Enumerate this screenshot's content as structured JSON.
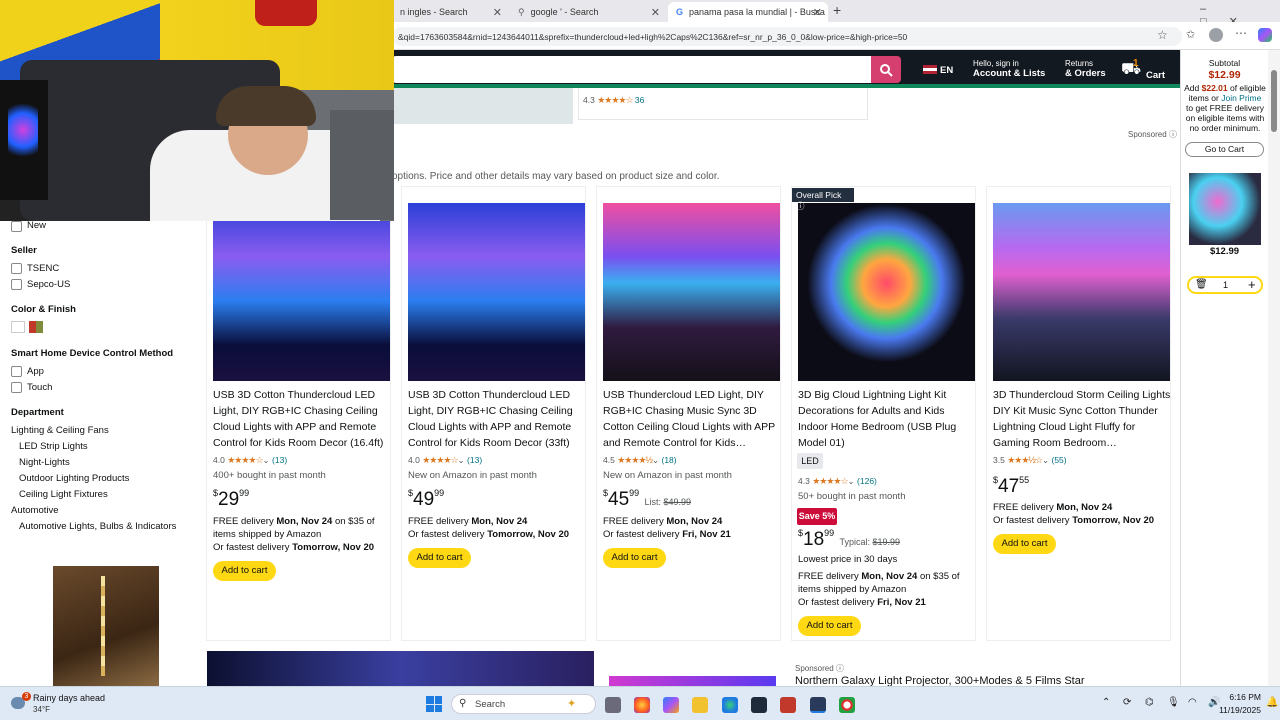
{
  "browser": {
    "tabs": [
      {
        "label": "n ingles - Search"
      },
      {
        "label": "google ' - Search"
      },
      {
        "label": "panama pasa la mundial | - Busca"
      }
    ],
    "url": "&qid=1763603584&rnid=1243644011&sprefix=thundercloud+led+ligh%2Caps%2C136&ref=sr_nr_p_36_0_0&low-price=&high-price=50"
  },
  "header": {
    "lang": "EN",
    "account_line1": "Hello, sign in",
    "account_line2": "Account & Lists",
    "returns_line1": "Returns",
    "returns_line2": "& Orders",
    "cart_count": "1",
    "cart_label": "Cart"
  },
  "top_remnant": {
    "rating": "4.3",
    "count": "36"
  },
  "sponsored": "Sponsored",
  "disclaimer": "options. Price and other details may vary based on product size and color.",
  "sidebar": {
    "new_label": "New",
    "seller_heading": "Seller",
    "sellers": [
      "TSENC",
      "Sepco-US"
    ],
    "color_heading": "Color & Finish",
    "control_heading": "Smart Home Device Control Method",
    "controls": [
      "App",
      "Touch"
    ],
    "dept_heading": "Department",
    "departments": [
      "Lighting & Ceiling Fans",
      "LED Strip Lights",
      "Night-Lights",
      "Outdoor Lighting Products",
      "Ceiling Light Fixtures",
      "Automotive",
      "Automotive Lights, Bulbs & Indicators"
    ]
  },
  "products": [
    {
      "title": "USB 3D Cotton Thundercloud LED Light, DIY RGB+IC Chasing Ceiling Cloud Lights with APP and Remote Control for Kids Room Decor (16.4ft)",
      "rating": "4.0",
      "count": "(13)",
      "bought": "400+ bought in past month",
      "price_whole": "29",
      "price_frac": "99",
      "deliv1": "FREE delivery ",
      "deliv1b": "Mon, Nov 24",
      "deliv1c": " on $35 of items shipped by Amazon",
      "deliv2": "Or fastest delivery ",
      "deliv2b": "Tomorrow, Nov 20",
      "button": "Add to cart"
    },
    {
      "title": "USB 3D Cotton Thundercloud LED Light, DIY RGB+IC Chasing Ceiling Cloud Lights with APP and Remote Control for Kids Room Decor (33ft)",
      "rating": "4.0",
      "count": "(13)",
      "bought": "New on Amazon in past month",
      "price_whole": "49",
      "price_frac": "99",
      "deliv1": "FREE delivery ",
      "deliv1b": "Mon, Nov 24",
      "deliv2": "Or fastest delivery ",
      "deliv2b": "Tomorrow, Nov 20",
      "button": "Add to cart"
    },
    {
      "title": "USB Thundercloud LED Light, DIY RGB+IC Chasing Music Sync 3D Cotton Ceiling Cloud Lights with APP and Remote Control for Kids…",
      "rating": "4.5",
      "count": "(18)",
      "bought": "New on Amazon in past month",
      "price_whole": "45",
      "price_frac": "99",
      "list_label": "List: ",
      "list_price": "$49.99",
      "deliv1": "FREE delivery ",
      "deliv1b": "Mon, Nov 24",
      "deliv2": "Or fastest delivery ",
      "deliv2b": "Fri, Nov 21",
      "button": "Add to cart"
    },
    {
      "badge": "Overall Pick",
      "title": "3D Big Cloud Lightning Light Kit Decorations for Adults and Kids Indoor Home Bedroom (USB Plug Model 01)",
      "chip": "LED",
      "rating": "4.3",
      "count": "(126)",
      "bought": "50+ bought in past month",
      "save": "Save 5%",
      "price_whole": "18",
      "price_frac": "99",
      "typical_label": "Typical: ",
      "typical_price": "$19.99",
      "lowest": "Lowest price in 30 days",
      "deliv1": "FREE delivery ",
      "deliv1b": "Mon, Nov 24",
      "deliv1c": " on $35 of items shipped by Amazon",
      "deliv2": "Or fastest delivery ",
      "deliv2b": "Fri, Nov 21",
      "button": "Add to cart"
    },
    {
      "title": "3D Thundercloud Storm Ceiling Lights DIY Kit Music Sync Cotton Thunder Lightning Cloud Light Fluffy for Gaming Room Bedroom…",
      "rating": "3.5",
      "count": "(55)",
      "price_whole": "47",
      "price_frac": "55",
      "deliv1": "FREE delivery ",
      "deliv1b": "Mon, Nov 24",
      "deliv2": "Or fastest delivery ",
      "deliv2b": "Tomorrow, Nov 20",
      "button": "Add to cart"
    }
  ],
  "bottom_row": {
    "sponsored": "Sponsored",
    "title": "Northern Galaxy Light Projector, 300+Modes & 5 Films Star"
  },
  "cart_rail": {
    "subtotal_label": "Subtotal",
    "subtotal": "$12.99",
    "promo_a": "Add ",
    "promo_amount": "$22.01",
    "promo_b": " of eligible items or ",
    "promo_link": "Join Prime",
    "promo_c": " to get FREE delivery on eligible items with no order minimum.",
    "go_to_cart": "Go to Cart",
    "item_price": "$12.99",
    "qty": "1"
  },
  "taskbar": {
    "weather_title": "Rainy days ahead",
    "weather_temp": "34°F",
    "weather_badge": "3",
    "search_placeholder": "Search",
    "time": "6:16 PM",
    "date": "11/19/2025"
  },
  "colors": {
    "amazon_dark": "#131921",
    "accent_green": "#10875b",
    "atc_yellow": "#ffd814",
    "search_btn": "#d43f6f",
    "save_red": "#cc0c39"
  }
}
